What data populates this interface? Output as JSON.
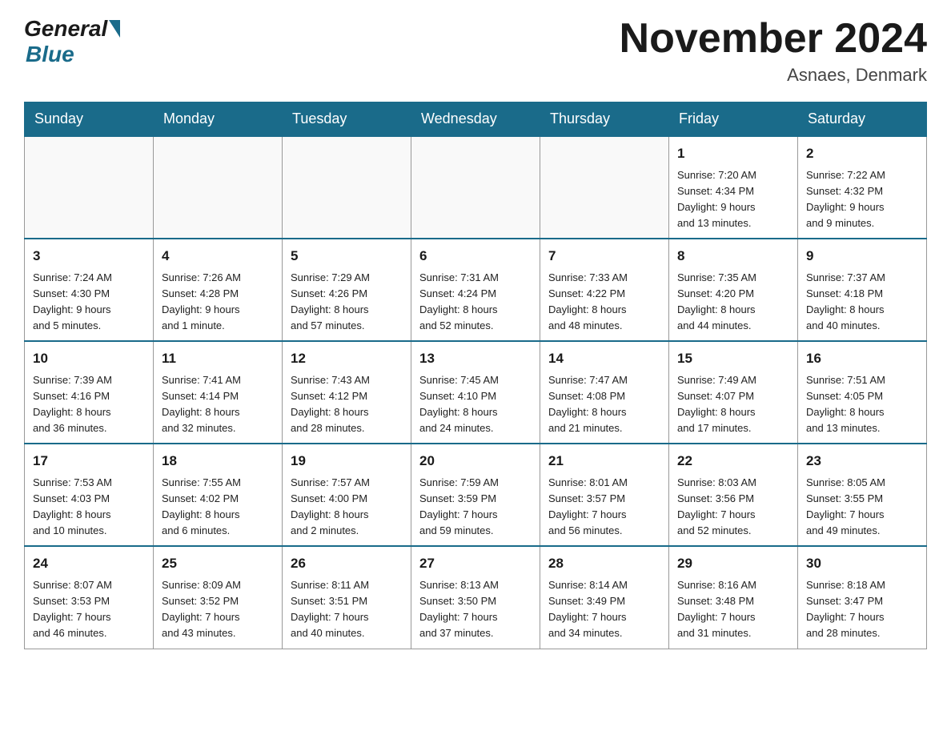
{
  "header": {
    "logo_general": "General",
    "logo_blue": "Blue",
    "month_year": "November 2024",
    "location": "Asnaes, Denmark"
  },
  "weekdays": [
    "Sunday",
    "Monday",
    "Tuesday",
    "Wednesday",
    "Thursday",
    "Friday",
    "Saturday"
  ],
  "weeks": [
    [
      {
        "day": "",
        "info": ""
      },
      {
        "day": "",
        "info": ""
      },
      {
        "day": "",
        "info": ""
      },
      {
        "day": "",
        "info": ""
      },
      {
        "day": "",
        "info": ""
      },
      {
        "day": "1",
        "info": "Sunrise: 7:20 AM\nSunset: 4:34 PM\nDaylight: 9 hours\nand 13 minutes."
      },
      {
        "day": "2",
        "info": "Sunrise: 7:22 AM\nSunset: 4:32 PM\nDaylight: 9 hours\nand 9 minutes."
      }
    ],
    [
      {
        "day": "3",
        "info": "Sunrise: 7:24 AM\nSunset: 4:30 PM\nDaylight: 9 hours\nand 5 minutes."
      },
      {
        "day": "4",
        "info": "Sunrise: 7:26 AM\nSunset: 4:28 PM\nDaylight: 9 hours\nand 1 minute."
      },
      {
        "day": "5",
        "info": "Sunrise: 7:29 AM\nSunset: 4:26 PM\nDaylight: 8 hours\nand 57 minutes."
      },
      {
        "day": "6",
        "info": "Sunrise: 7:31 AM\nSunset: 4:24 PM\nDaylight: 8 hours\nand 52 minutes."
      },
      {
        "day": "7",
        "info": "Sunrise: 7:33 AM\nSunset: 4:22 PM\nDaylight: 8 hours\nand 48 minutes."
      },
      {
        "day": "8",
        "info": "Sunrise: 7:35 AM\nSunset: 4:20 PM\nDaylight: 8 hours\nand 44 minutes."
      },
      {
        "day": "9",
        "info": "Sunrise: 7:37 AM\nSunset: 4:18 PM\nDaylight: 8 hours\nand 40 minutes."
      }
    ],
    [
      {
        "day": "10",
        "info": "Sunrise: 7:39 AM\nSunset: 4:16 PM\nDaylight: 8 hours\nand 36 minutes."
      },
      {
        "day": "11",
        "info": "Sunrise: 7:41 AM\nSunset: 4:14 PM\nDaylight: 8 hours\nand 32 minutes."
      },
      {
        "day": "12",
        "info": "Sunrise: 7:43 AM\nSunset: 4:12 PM\nDaylight: 8 hours\nand 28 minutes."
      },
      {
        "day": "13",
        "info": "Sunrise: 7:45 AM\nSunset: 4:10 PM\nDaylight: 8 hours\nand 24 minutes."
      },
      {
        "day": "14",
        "info": "Sunrise: 7:47 AM\nSunset: 4:08 PM\nDaylight: 8 hours\nand 21 minutes."
      },
      {
        "day": "15",
        "info": "Sunrise: 7:49 AM\nSunset: 4:07 PM\nDaylight: 8 hours\nand 17 minutes."
      },
      {
        "day": "16",
        "info": "Sunrise: 7:51 AM\nSunset: 4:05 PM\nDaylight: 8 hours\nand 13 minutes."
      }
    ],
    [
      {
        "day": "17",
        "info": "Sunrise: 7:53 AM\nSunset: 4:03 PM\nDaylight: 8 hours\nand 10 minutes."
      },
      {
        "day": "18",
        "info": "Sunrise: 7:55 AM\nSunset: 4:02 PM\nDaylight: 8 hours\nand 6 minutes."
      },
      {
        "day": "19",
        "info": "Sunrise: 7:57 AM\nSunset: 4:00 PM\nDaylight: 8 hours\nand 2 minutes."
      },
      {
        "day": "20",
        "info": "Sunrise: 7:59 AM\nSunset: 3:59 PM\nDaylight: 7 hours\nand 59 minutes."
      },
      {
        "day": "21",
        "info": "Sunrise: 8:01 AM\nSunset: 3:57 PM\nDaylight: 7 hours\nand 56 minutes."
      },
      {
        "day": "22",
        "info": "Sunrise: 8:03 AM\nSunset: 3:56 PM\nDaylight: 7 hours\nand 52 minutes."
      },
      {
        "day": "23",
        "info": "Sunrise: 8:05 AM\nSunset: 3:55 PM\nDaylight: 7 hours\nand 49 minutes."
      }
    ],
    [
      {
        "day": "24",
        "info": "Sunrise: 8:07 AM\nSunset: 3:53 PM\nDaylight: 7 hours\nand 46 minutes."
      },
      {
        "day": "25",
        "info": "Sunrise: 8:09 AM\nSunset: 3:52 PM\nDaylight: 7 hours\nand 43 minutes."
      },
      {
        "day": "26",
        "info": "Sunrise: 8:11 AM\nSunset: 3:51 PM\nDaylight: 7 hours\nand 40 minutes."
      },
      {
        "day": "27",
        "info": "Sunrise: 8:13 AM\nSunset: 3:50 PM\nDaylight: 7 hours\nand 37 minutes."
      },
      {
        "day": "28",
        "info": "Sunrise: 8:14 AM\nSunset: 3:49 PM\nDaylight: 7 hours\nand 34 minutes."
      },
      {
        "day": "29",
        "info": "Sunrise: 8:16 AM\nSunset: 3:48 PM\nDaylight: 7 hours\nand 31 minutes."
      },
      {
        "day": "30",
        "info": "Sunrise: 8:18 AM\nSunset: 3:47 PM\nDaylight: 7 hours\nand 28 minutes."
      }
    ]
  ]
}
